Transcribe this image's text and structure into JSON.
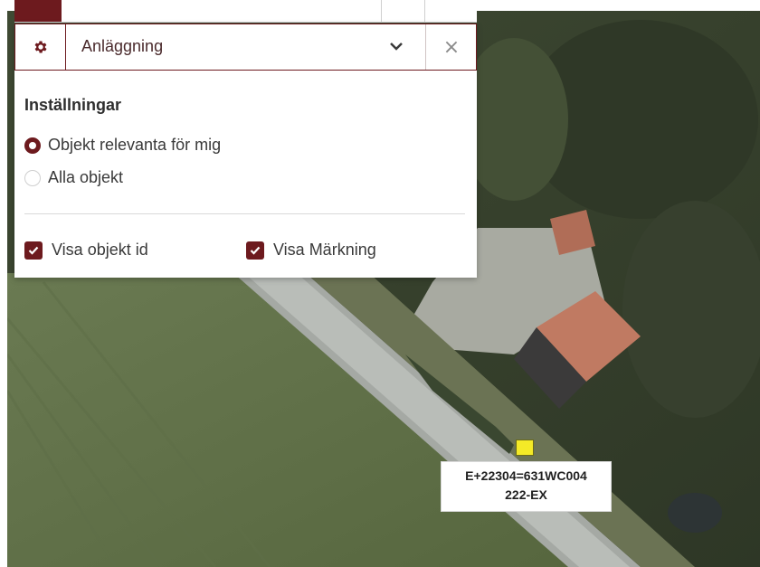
{
  "panel": {
    "select_label": "Anläggning",
    "close_symbol": "×",
    "settings_title": "Inställningar",
    "radios": [
      {
        "label": "Objekt relevanta för mig",
        "checked": true
      },
      {
        "label": "Alla objekt",
        "checked": false
      }
    ],
    "checkboxes": [
      {
        "label": "Visa objekt id",
        "checked": true
      },
      {
        "label": "Visa Märkning",
        "checked": true
      }
    ]
  },
  "map": {
    "marker_label_line1": "E+22304=631WC004",
    "marker_label_line2": "222-EX"
  },
  "icons": {
    "settings": "gear-icon",
    "dropdown": "chevron-down-icon",
    "close": "close-icon"
  },
  "colors": {
    "accent": "#6d1a1e",
    "marker": "#f4ea27"
  }
}
